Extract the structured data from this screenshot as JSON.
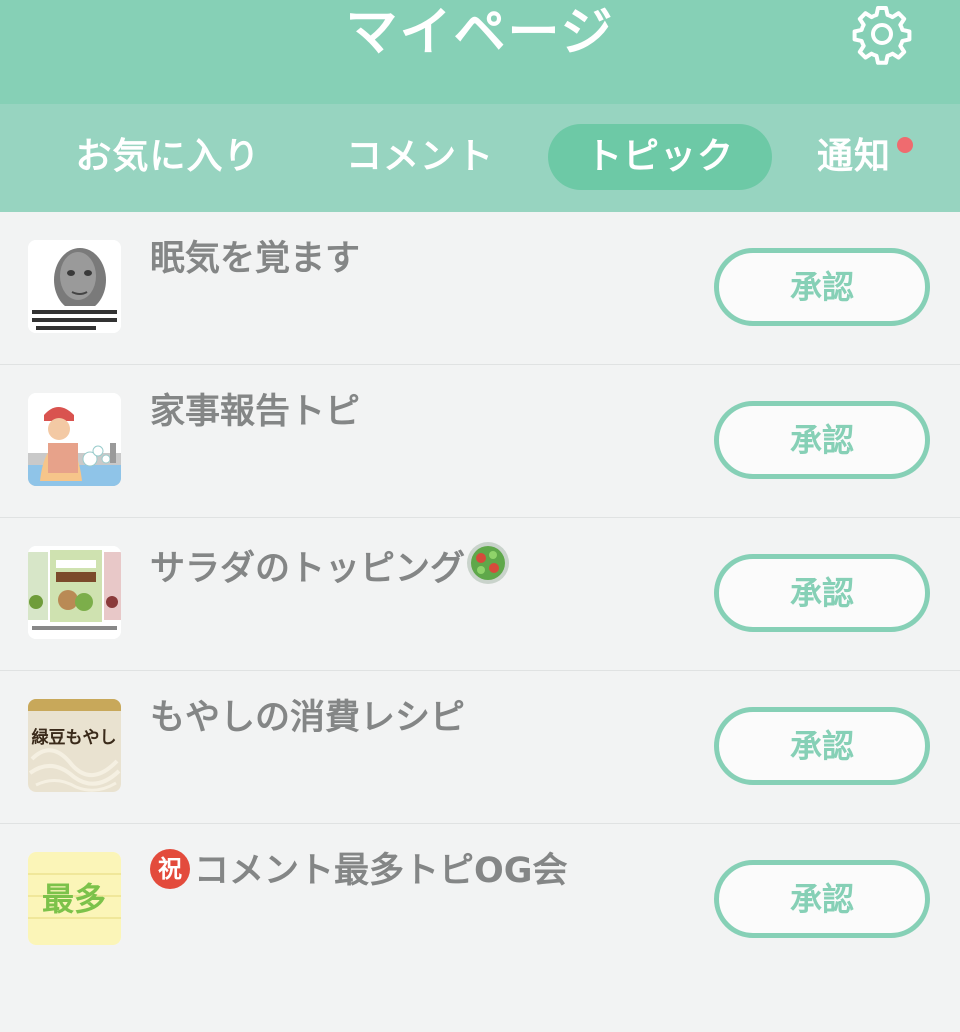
{
  "header": {
    "title": "マイページ"
  },
  "tabs": [
    {
      "label": "お気に入り",
      "active": false
    },
    {
      "label": "コメント",
      "active": false
    },
    {
      "label": "トピック",
      "active": true
    },
    {
      "label": "通知",
      "active": false,
      "has_badge": true
    }
  ],
  "colors": {
    "header": "#86d0b6",
    "tab_bar": "#97d4c0",
    "active_tab": "#6dc9a6",
    "badge": "#ef6b6f",
    "title_text": "#848686",
    "button": "#86d0b6"
  },
  "topics": [
    {
      "title": "眠気を覚ます",
      "thumb_icon": "face-photo-thumbnail",
      "thumb_caption": "眠いテレビを見た後ようやく眠たくなってウトウトしてたらベッドでしたようです",
      "button": "承認"
    },
    {
      "title": "家事報告トピ",
      "thumb_icon": "dishwashing-illustration-thumbnail",
      "button": "承認"
    },
    {
      "title": "サラダのトッピング",
      "title_icon": "salad-emoji",
      "thumb_icon": "salad-topping-packages-thumbnail",
      "button": "承認"
    },
    {
      "title": "もやしの消費レシピ",
      "thumb_icon": "bean-sprouts-package-thumbnail",
      "thumb_text": "緑豆もやし",
      "button": "承認"
    },
    {
      "title": "コメント最多トピOG会",
      "title_prefix": "祝",
      "thumb_icon": "most-comments-badge-thumbnail",
      "thumb_text": "最多",
      "button": "承認"
    }
  ]
}
